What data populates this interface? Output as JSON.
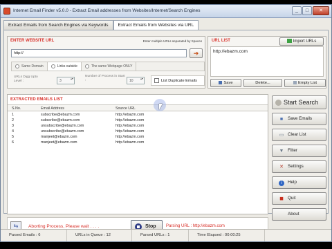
{
  "window": {
    "title": "Internet Email Finder v5.0.0  -  Extract Email addresses from Websites/Internet/Search Engines",
    "minimize": "_",
    "maximize": "□",
    "close": "✕"
  },
  "tabs": [
    {
      "label": "Extract Emails from Search Engines via Keywords"
    },
    {
      "label": "Extract Emails from Websites via URL"
    }
  ],
  "website": {
    "title": "ENTER WEBSITE URL",
    "hint": "Enter multiple URLs separated by Spaces",
    "url_value": "http://",
    "options": [
      "Same Domain",
      "Links outside",
      "The same Webpage ONLY"
    ],
    "dig_label": "URLs Digg Upto Level :",
    "dig_value": "3",
    "threads_label": "Number of Process in Start :",
    "threads_value": "10",
    "list_duplicate_label": "List Duplicate Emails"
  },
  "url_list": {
    "title": "URL LIST",
    "import_label": "Import URLs",
    "items": [
      "http://ebazm.com"
    ],
    "save_label": "Save",
    "delete_label": "Delete...",
    "empty_label": "Empty List"
  },
  "emails": {
    "title": "EXTRACTED EMAILS LIST",
    "columns": [
      "S.No.",
      "Email Address",
      "Source URL"
    ],
    "rows": [
      [
        "1",
        "subscribe@ebazm.com",
        "http://ebazm.com"
      ],
      [
        "2",
        "subscribe@ebazm.com",
        "http://ebazm.com"
      ],
      [
        "3",
        "unsubscribe@ebazm.com",
        "http://ebazm.com"
      ],
      [
        "4",
        "unsubscribe@ebazm.com",
        "http://ebazm.com"
      ],
      [
        "5",
        "manjeet@ebazm.com",
        "http://ebazm.com"
      ],
      [
        "6",
        "manjeet@ebazm.com",
        "http://ebazm.com"
      ]
    ]
  },
  "side_buttons": {
    "start": "Start Search",
    "save_emails": "Save Emails",
    "clear_list": "Clear List",
    "filter": "Filter",
    "settings": "Settings",
    "help": "Help",
    "quit": "Quit",
    "about": "About"
  },
  "process": {
    "message": "Aborting Process, Please wait . . . .",
    "stop_label": "Stop",
    "parsing": "Parsing URL : http://ebazm.com"
  },
  "status": {
    "parsed": "Parsed Emails :  6",
    "queue": "URLs in Queue :  12",
    "parsed_urls": "Parsed URLs :  1",
    "elapsed": "Time Elapsed :  00:00:25"
  }
}
